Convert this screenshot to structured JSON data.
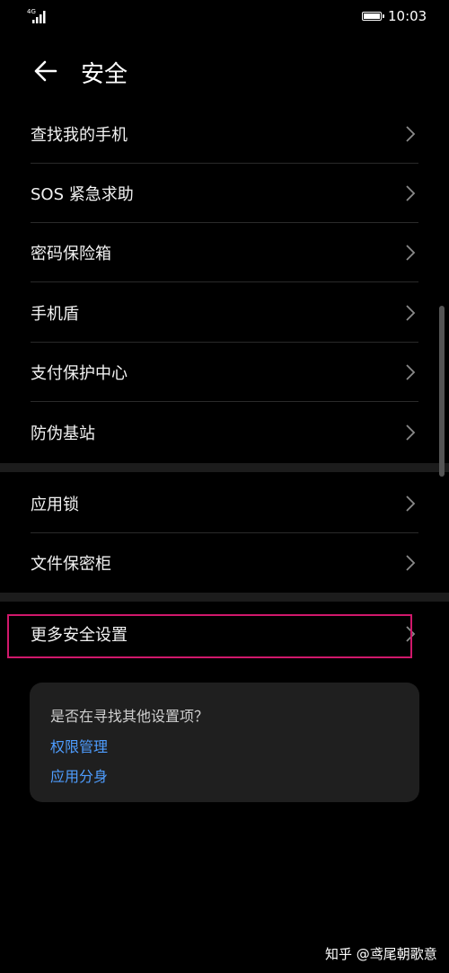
{
  "status_bar": {
    "network": "4G",
    "time": "10:03"
  },
  "header": {
    "title": "安全"
  },
  "section1": [
    {
      "label": "查找我的手机"
    },
    {
      "label": "SOS 紧急求助"
    },
    {
      "label": "密码保险箱"
    },
    {
      "label": "手机盾"
    },
    {
      "label": "支付保护中心"
    },
    {
      "label": "防伪基站"
    }
  ],
  "section2": [
    {
      "label": "应用锁"
    },
    {
      "label": "文件保密柜"
    }
  ],
  "section3": [
    {
      "label": "更多安全设置"
    }
  ],
  "suggestions": {
    "question": "是否在寻找其他设置项？",
    "links": [
      {
        "label": "权限管理"
      },
      {
        "label": "应用分身"
      }
    ]
  },
  "watermark": "知乎 @鸢尾朝歌意",
  "colors": {
    "background": "#000000",
    "link": "#4e9dff",
    "highlight": "#d0186b"
  }
}
